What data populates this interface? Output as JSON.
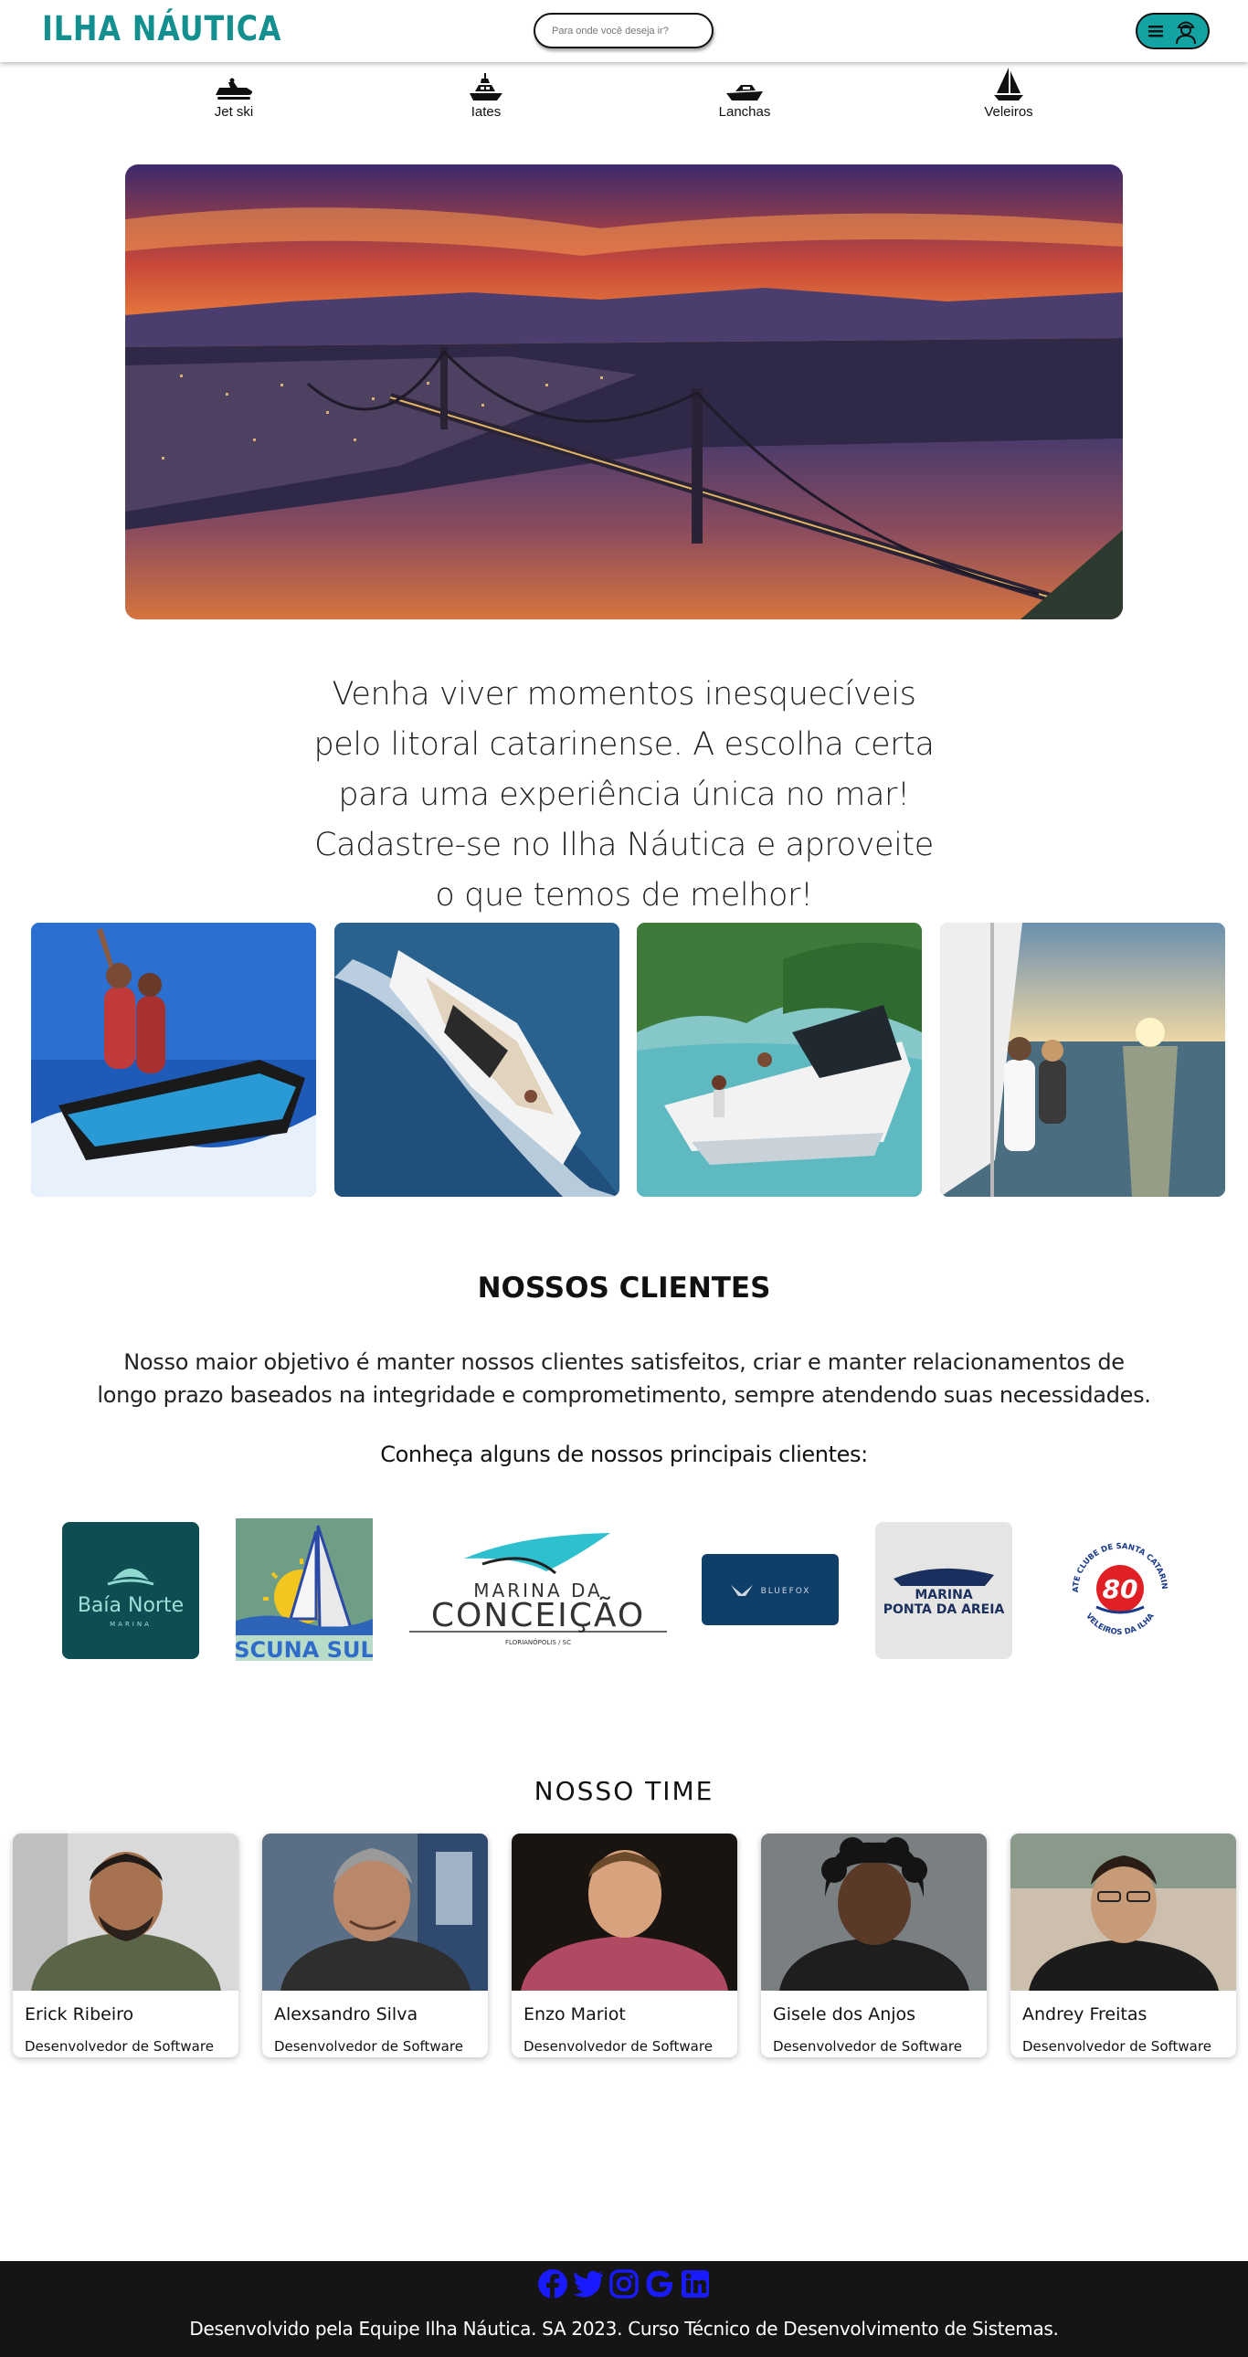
{
  "header": {
    "logo": "ILHA NÁUTICA",
    "search_placeholder": "Para onde você deseja ir?",
    "menu_icons": [
      "hamburger-icon",
      "user-icon"
    ],
    "accent_color": "#14a3a3"
  },
  "categories": [
    {
      "label": "Jet ski",
      "icon": "jetski-icon"
    },
    {
      "label": "Iates",
      "icon": "yacht-icon"
    },
    {
      "label": "Lanchas",
      "icon": "speedboat-icon"
    },
    {
      "label": "Veleiros",
      "icon": "sailboat-icon"
    }
  ],
  "tagline": "Venha viver momentos inesquecíveis pelo litoral catarinense. A escolha certa para uma experiência única no mar! Cadastre-se no Ilha Náutica e aproveite o que temos de melhor!",
  "clients": {
    "title": "NOSSOS CLIENTES",
    "description": "Nosso maior objetivo é manter nossos clientes satisfeitos, criar e manter relacionamentos de longo prazo baseados na integridade e comprometimento, sempre atendendo suas necessidades.",
    "subtitle": "Conheça alguns de nossos principais clientes:",
    "logos": [
      {
        "name": "Baía Norte",
        "sub": "MARINA"
      },
      {
        "name": "SCUNA SUL"
      },
      {
        "name": "MARINA DA",
        "line2": "CONCEIÇÃO",
        "sub": "FLORIANÓPOLIS / SC"
      },
      {
        "name": "BLUEFOX"
      },
      {
        "name": "MARINA",
        "line2": "PONTA DA AREIA"
      },
      {
        "name": "IATE CLUBE DE SANTA CATARINA",
        "sub": "VELEIROS DA ILHA",
        "badge": "80"
      }
    ]
  },
  "team": {
    "title": "NOSSO TIME",
    "members": [
      {
        "name": "Erick Ribeiro",
        "role": "Desenvolvedor de Software"
      },
      {
        "name": "Alexsandro Silva",
        "role": "Desenvolvedor de Software"
      },
      {
        "name": "Enzo Mariot",
        "role": "Desenvolvedor de Software"
      },
      {
        "name": "Gisele dos Anjos",
        "role": "Desenvolvedor de Software"
      },
      {
        "name": "Andrey Freitas",
        "role": "Desenvolvedor de Software"
      }
    ]
  },
  "footer": {
    "socials": [
      "facebook-icon",
      "twitter-icon",
      "instagram-icon",
      "google-icon",
      "linkedin-icon"
    ],
    "social_color": "#1a1aff",
    "text": "Desenvolvido pela Equipe Ilha Náutica. SA 2023. Curso Técnico de Desenvolvimento de Sistemas."
  }
}
